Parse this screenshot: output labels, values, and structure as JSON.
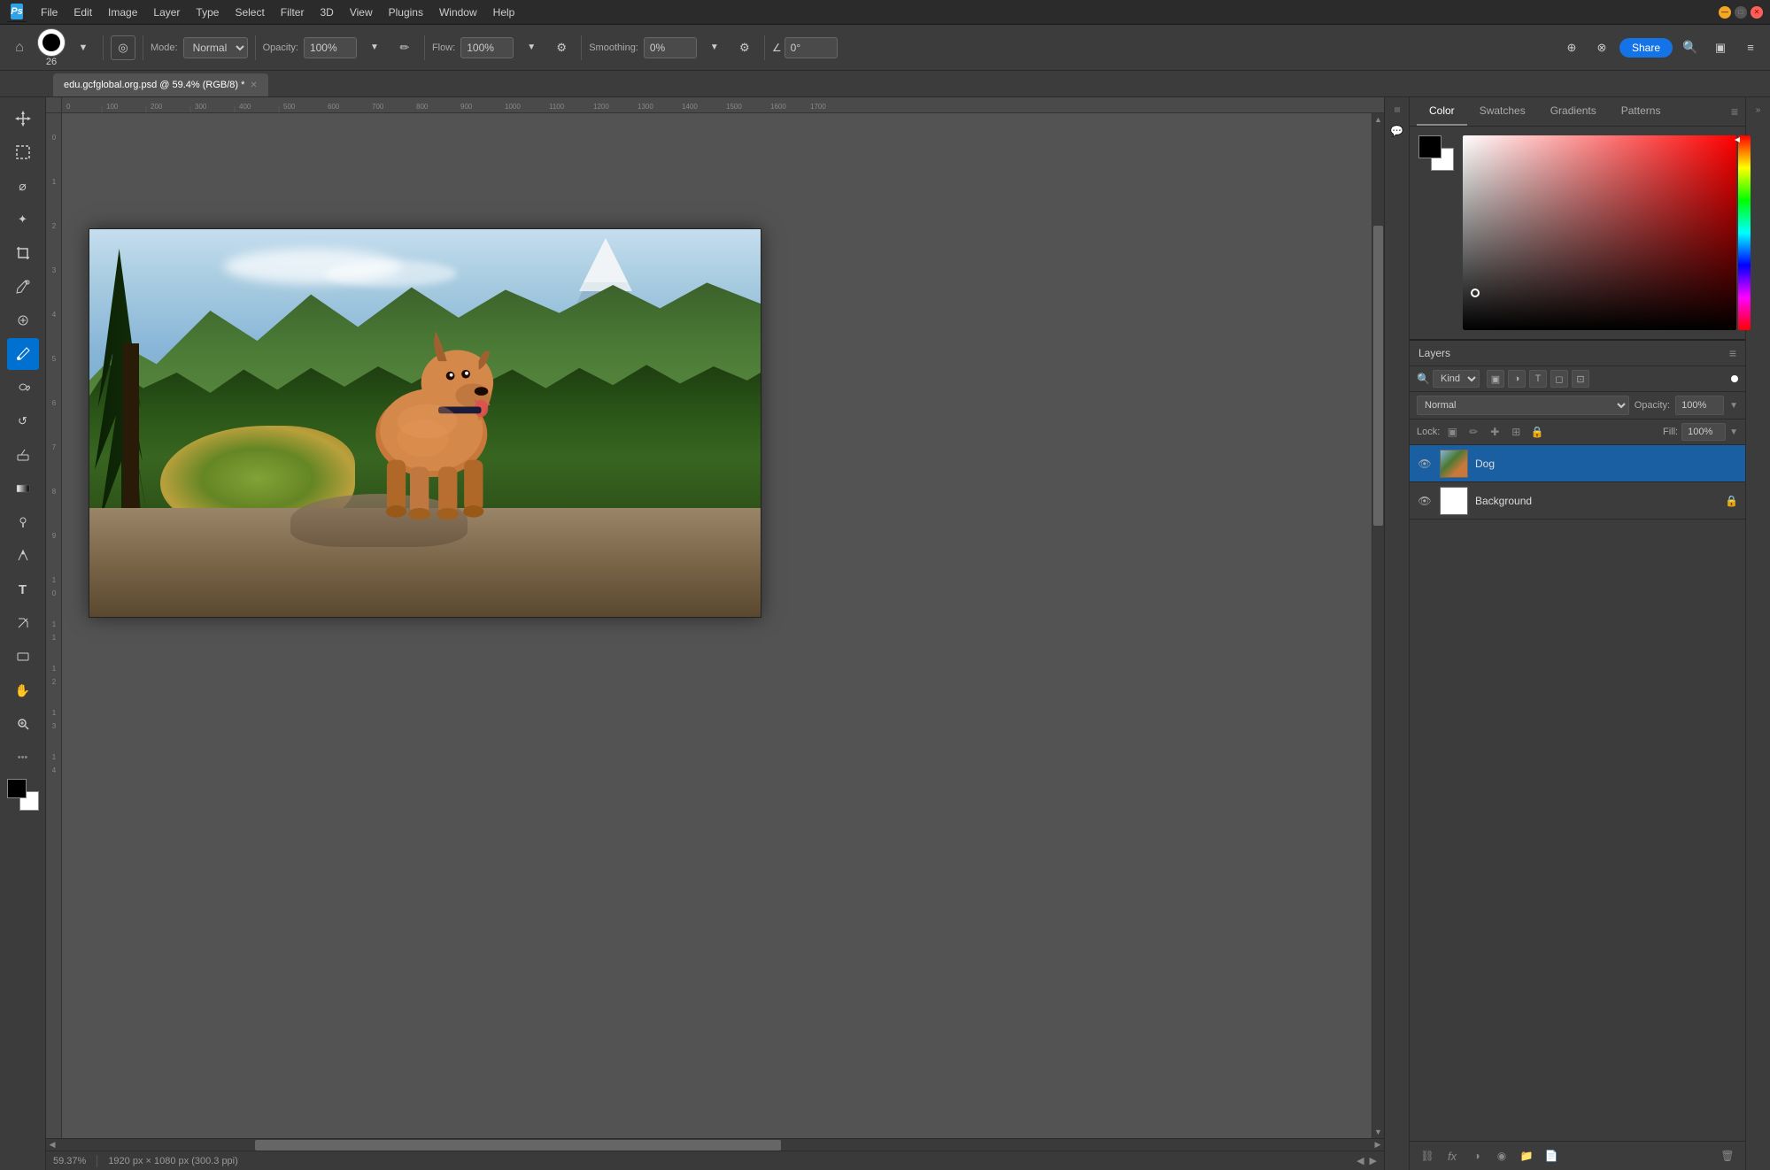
{
  "app": {
    "name": "Adobe Photoshop",
    "icon": "Ps"
  },
  "menu": {
    "items": [
      "File",
      "Edit",
      "Image",
      "Layer",
      "Type",
      "Select",
      "Filter",
      "3D",
      "View",
      "Plugins",
      "Window",
      "Help"
    ]
  },
  "toolbar": {
    "mode_label": "Mode:",
    "mode_value": "Normal",
    "opacity_label": "Opacity:",
    "opacity_value": "100%",
    "flow_label": "Flow:",
    "flow_value": "100%",
    "smoothing_label": "Smoothing:",
    "smoothing_value": "0%",
    "brush_size": "26",
    "angle_value": "0°",
    "share_label": "Share"
  },
  "tab": {
    "title": "edu.gcfglobal.org.psd @ 59.4% (RGB/8) *"
  },
  "color_panel": {
    "tabs": [
      "Color",
      "Swatches",
      "Gradients",
      "Patterns"
    ]
  },
  "layers_panel": {
    "title": "Layers",
    "filter_label": "Kind",
    "blend_mode": "Normal",
    "opacity_label": "Opacity:",
    "opacity_value": "100%",
    "fill_label": "Fill:",
    "fill_value": "100%",
    "lock_label": "Lock:",
    "layers": [
      {
        "name": "Dog",
        "visible": true,
        "locked": false,
        "thumb_type": "dog"
      },
      {
        "name": "Background",
        "visible": true,
        "locked": true,
        "thumb_type": "bg"
      }
    ]
  },
  "status_bar": {
    "zoom": "59.37%",
    "info": "1920 px × 1080 px (300.3 ppi)"
  }
}
